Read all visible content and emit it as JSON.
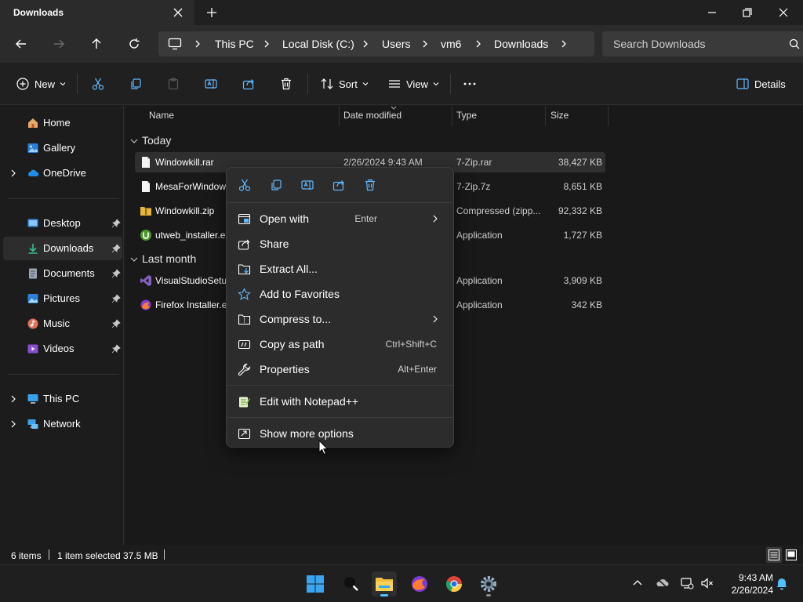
{
  "window": {
    "tab_title": "Downloads"
  },
  "address": {
    "crumbs": [
      "This PC",
      "Local Disk (C:)",
      "Users",
      "vm6",
      "Downloads"
    ],
    "search_placeholder": "Search Downloads"
  },
  "commandbar": {
    "new_label": "New",
    "sort_label": "Sort",
    "view_label": "View",
    "details_label": "Details"
  },
  "sidebar": {
    "items": [
      {
        "label": "Home",
        "icon": "home-icon"
      },
      {
        "label": "Gallery",
        "icon": "gallery-icon"
      },
      {
        "label": "OneDrive",
        "icon": "cloud-icon"
      },
      {
        "label": "Desktop",
        "icon": "desktop-icon"
      },
      {
        "label": "Downloads",
        "icon": "download-icon"
      },
      {
        "label": "Documents",
        "icon": "documents-icon"
      },
      {
        "label": "Pictures",
        "icon": "pictures-icon"
      },
      {
        "label": "Music",
        "icon": "music-icon"
      },
      {
        "label": "Videos",
        "icon": "videos-icon"
      },
      {
        "label": "This PC",
        "icon": "pc-icon"
      },
      {
        "label": "Network",
        "icon": "network-icon"
      }
    ]
  },
  "list": {
    "columns": [
      "Name",
      "Date modified",
      "Type",
      "Size"
    ],
    "groups": [
      {
        "label": "Today",
        "rows": [
          {
            "name": "Windowkill.rar",
            "date": "2/26/2024 9:43 AM",
            "type": "7-Zip.rar",
            "size": "38,427 KB",
            "icon": "file-icon"
          },
          {
            "name": "MesaForWindow",
            "date": "",
            "type": "7-Zip.7z",
            "size": "8,651 KB",
            "icon": "file-icon"
          },
          {
            "name": "Windowkill.zip",
            "date": "",
            "type": "Compressed (zipp...",
            "size": "92,332 KB",
            "icon": "zip-folder-icon"
          },
          {
            "name": "utweb_installer.e",
            "date": "",
            "type": "Application",
            "size": "1,727 KB",
            "icon": "utorrent-icon"
          }
        ]
      },
      {
        "label": "Last month",
        "rows": [
          {
            "name": "VisualStudioSetu",
            "date": "",
            "type": "Application",
            "size": "3,909 KB",
            "icon": "visual-studio-icon"
          },
          {
            "name": "Firefox Installer.e",
            "date": "",
            "type": "Application",
            "size": "342 KB",
            "icon": "firefox-installer-icon"
          }
        ]
      }
    ]
  },
  "context_menu": {
    "items": [
      {
        "label": "Open with",
        "shortcut": "Enter",
        "icon": "open-with-icon"
      },
      {
        "label": "Share",
        "shortcut": "",
        "icon": "share-icon"
      },
      {
        "label": "Extract All...",
        "shortcut": "",
        "icon": "extract-icon"
      },
      {
        "label": "Add to Favorites",
        "shortcut": "",
        "icon": "star-icon"
      },
      {
        "label": "Compress to...",
        "shortcut": "",
        "icon": "compress-icon"
      },
      {
        "label": "Copy as path",
        "shortcut": "Ctrl+Shift+C",
        "icon": "copy-path-icon"
      },
      {
        "label": "Properties",
        "shortcut": "Alt+Enter",
        "icon": "wrench-icon"
      },
      {
        "label": "Edit with Notepad++",
        "shortcut": "",
        "icon": "notepadpp-icon"
      },
      {
        "label": "Show more options",
        "shortcut": "",
        "icon": "more-options-icon"
      }
    ]
  },
  "status": {
    "items_count": "6 items",
    "selection": "1 item selected",
    "selection_size": "37.5 MB"
  },
  "taskbar": {
    "time": "9:43 AM",
    "date": "2/26/2024"
  },
  "colors": {
    "accent": "#4cc2ff",
    "folder": "#e8b73a",
    "window_bg": "#1c1c1c"
  }
}
